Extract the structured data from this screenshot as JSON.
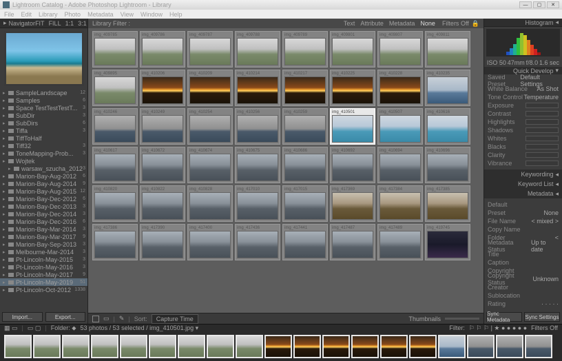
{
  "window": {
    "title": "Lightroom Catalog - Adobe Photoshop Lightroom - Library",
    "min": "—",
    "max": "▢",
    "close": "✕"
  },
  "menu": [
    "File",
    "Edit",
    "Library",
    "Photo",
    "Metadata",
    "View",
    "Window",
    "Help"
  ],
  "navigator": {
    "title": "Navigator",
    "modes": [
      "FIT",
      "FILL",
      "1:1",
      "3:1"
    ]
  },
  "folders": [
    {
      "n": "SampleLandscape",
      "c": 12
    },
    {
      "n": "Samples",
      "c": 6
    },
    {
      "n": "Space TestTestTestT...",
      "c": 3
    },
    {
      "n": "SubDir",
      "c": 3
    },
    {
      "n": "SubDirs",
      "c": 6
    },
    {
      "n": "Tiffa",
      "c": 3
    },
    {
      "n": "TiffToHalf",
      "c": ""
    },
    {
      "n": "Tiff32",
      "c": 3
    },
    {
      "n": "ToneMapping-Prob...",
      "c": 3
    },
    {
      "n": "Wojtek",
      "c": ""
    },
    {
      "n": "warsaw_szucha_2012",
      "c": 3,
      "indent": true
    },
    {
      "n": "Marion-Bay-Aug-2012",
      "c": 6
    },
    {
      "n": "Marion-Bay-Aug-2014",
      "c": 9
    },
    {
      "n": "Marion-Bay-Aug-2015",
      "c": 12
    },
    {
      "n": "Marion-Bay-Dec-2012",
      "c": 6
    },
    {
      "n": "Marion-Bay-Dec-2013",
      "c": 3
    },
    {
      "n": "Marion-Bay-Dec-2014",
      "c": 3
    },
    {
      "n": "Marion-Bay-Dec-2016",
      "c": 6
    },
    {
      "n": "Marion-Bay-Mar-2014",
      "c": 3
    },
    {
      "n": "Marion-Bay-Mar-2017",
      "c": 9
    },
    {
      "n": "Marion-Bay-Sep-2013",
      "c": 3
    },
    {
      "n": "Melbourne-Mar-2014",
      "c": 3
    },
    {
      "n": "Pt-Lincoln-May-2015",
      "c": 3
    },
    {
      "n": "Pt-Lincoln-May-2016",
      "c": 3
    },
    {
      "n": "Pt-Lincoln-May-2017",
      "c": 9
    },
    {
      "n": "Pt-Lincoln-May-2019",
      "c": 51,
      "sel": true
    },
    {
      "n": "Pt-Lincoln-Oct-2012",
      "c": 1338
    }
  ],
  "buttons": {
    "import": "Import...",
    "export": "Export..."
  },
  "filter": {
    "label": "Library Filter :",
    "tabs": [
      "Text",
      "Attribute",
      "Metadata",
      "None"
    ],
    "preset": "Filters Off"
  },
  "thumbs": [
    [
      "img_409785",
      "img_409786",
      "img_409787",
      "img_409788",
      "img_409789",
      "img_409801",
      "img_409807",
      "img_409811"
    ],
    [
      "img_409895",
      "img_410206",
      "img_410209",
      "img_410214",
      "img_410217",
      "img_410225",
      "img_410228",
      "img_410235"
    ],
    [
      "img_410246",
      "img_410249",
      "img_410254",
      "img_410256",
      "img_410259",
      "img_410501",
      "img_410507",
      "img_410616"
    ],
    [
      "img_410617",
      "img_410672",
      "img_410674",
      "img_410675",
      "img_410686",
      "img_410692",
      "img_410694",
      "img_410696"
    ],
    [
      "img_410820",
      "img_410822",
      "img_410828",
      "img_417010",
      "img_417015",
      "img_417369",
      "img_417384",
      "img_417385"
    ],
    [
      "img_417386",
      "img_417390",
      "img_417400",
      "img_417436",
      "img_417441",
      "img_417487",
      "img_417489",
      "img_419745"
    ]
  ],
  "thumbStyles": [
    [
      "r",
      "r",
      "r",
      "r",
      "r",
      "r",
      "r",
      "r"
    ],
    [
      "r",
      "s",
      "s",
      "s",
      "s",
      "s",
      "s",
      "c"
    ],
    [
      "h",
      "h",
      "h",
      "h",
      "h",
      "b",
      "b",
      "b"
    ],
    [
      "g",
      "g",
      "g",
      "g",
      "g",
      "g",
      "g",
      "g"
    ],
    [
      "g",
      "g",
      "g",
      "g",
      "g",
      "cl",
      "cl",
      "cl"
    ],
    [
      "g",
      "g",
      "g",
      "g",
      "g",
      "g",
      "g",
      "n"
    ]
  ],
  "selectedThumb": [
    2,
    5
  ],
  "toolbar": {
    "sort": "Capture Time",
    "right": "Thumbnails"
  },
  "histogram": {
    "title": "Histogram",
    "iso": "ISO 50",
    "ap": "47mm",
    "sh": "f/8.0",
    "ev": "1.6 sec"
  },
  "quickdev": {
    "title": "Quick Develop",
    "preset": {
      "lb": "Saved Preset",
      "vl": "Default Settings"
    },
    "wb": {
      "lb": "White Balance",
      "vl": "As Shot"
    },
    "tone": {
      "lb": "Tone Control",
      "vl": "Temperature"
    },
    "sliders": [
      "Exposure",
      "Contrast",
      "Highlights",
      "Shadows",
      "Whites",
      "Blacks",
      "Clarity",
      "Vibrance"
    ]
  },
  "rsections": [
    "Keywording",
    "Keyword List",
    "Metadata"
  ],
  "metadata": {
    "preset": {
      "lb": "Preset",
      "vl": "None"
    },
    "rows": [
      {
        "lb": "File Name",
        "vl": "< mixed >"
      },
      {
        "lb": "Copy Name",
        "vl": ""
      },
      {
        "lb": "Folder",
        "vl": "< "
      },
      {
        "lb": "Metadata Status",
        "vl": "Up to date"
      },
      {
        "lb": "Title",
        "vl": ""
      },
      {
        "lb": "Caption",
        "vl": ""
      },
      {
        "lb": "Copyright",
        "vl": ""
      },
      {
        "lb": "Copyright Status",
        "vl": "Unknown"
      },
      {
        "lb": "Creator",
        "vl": ""
      },
      {
        "lb": "Sublocation",
        "vl": ""
      },
      {
        "lb": "Rating",
        "vl": "· · · · ·"
      }
    ],
    "mode": "Default"
  },
  "sync": {
    "meta": "Sync Metadata",
    "set": "Sync Settings"
  },
  "filmstrip": {
    "info": "53 photos / 53 selected / img_410501.jpg ▾",
    "folder": "Folder: ⬥",
    "filter": "Filter:",
    "foff": "Filters Off"
  }
}
